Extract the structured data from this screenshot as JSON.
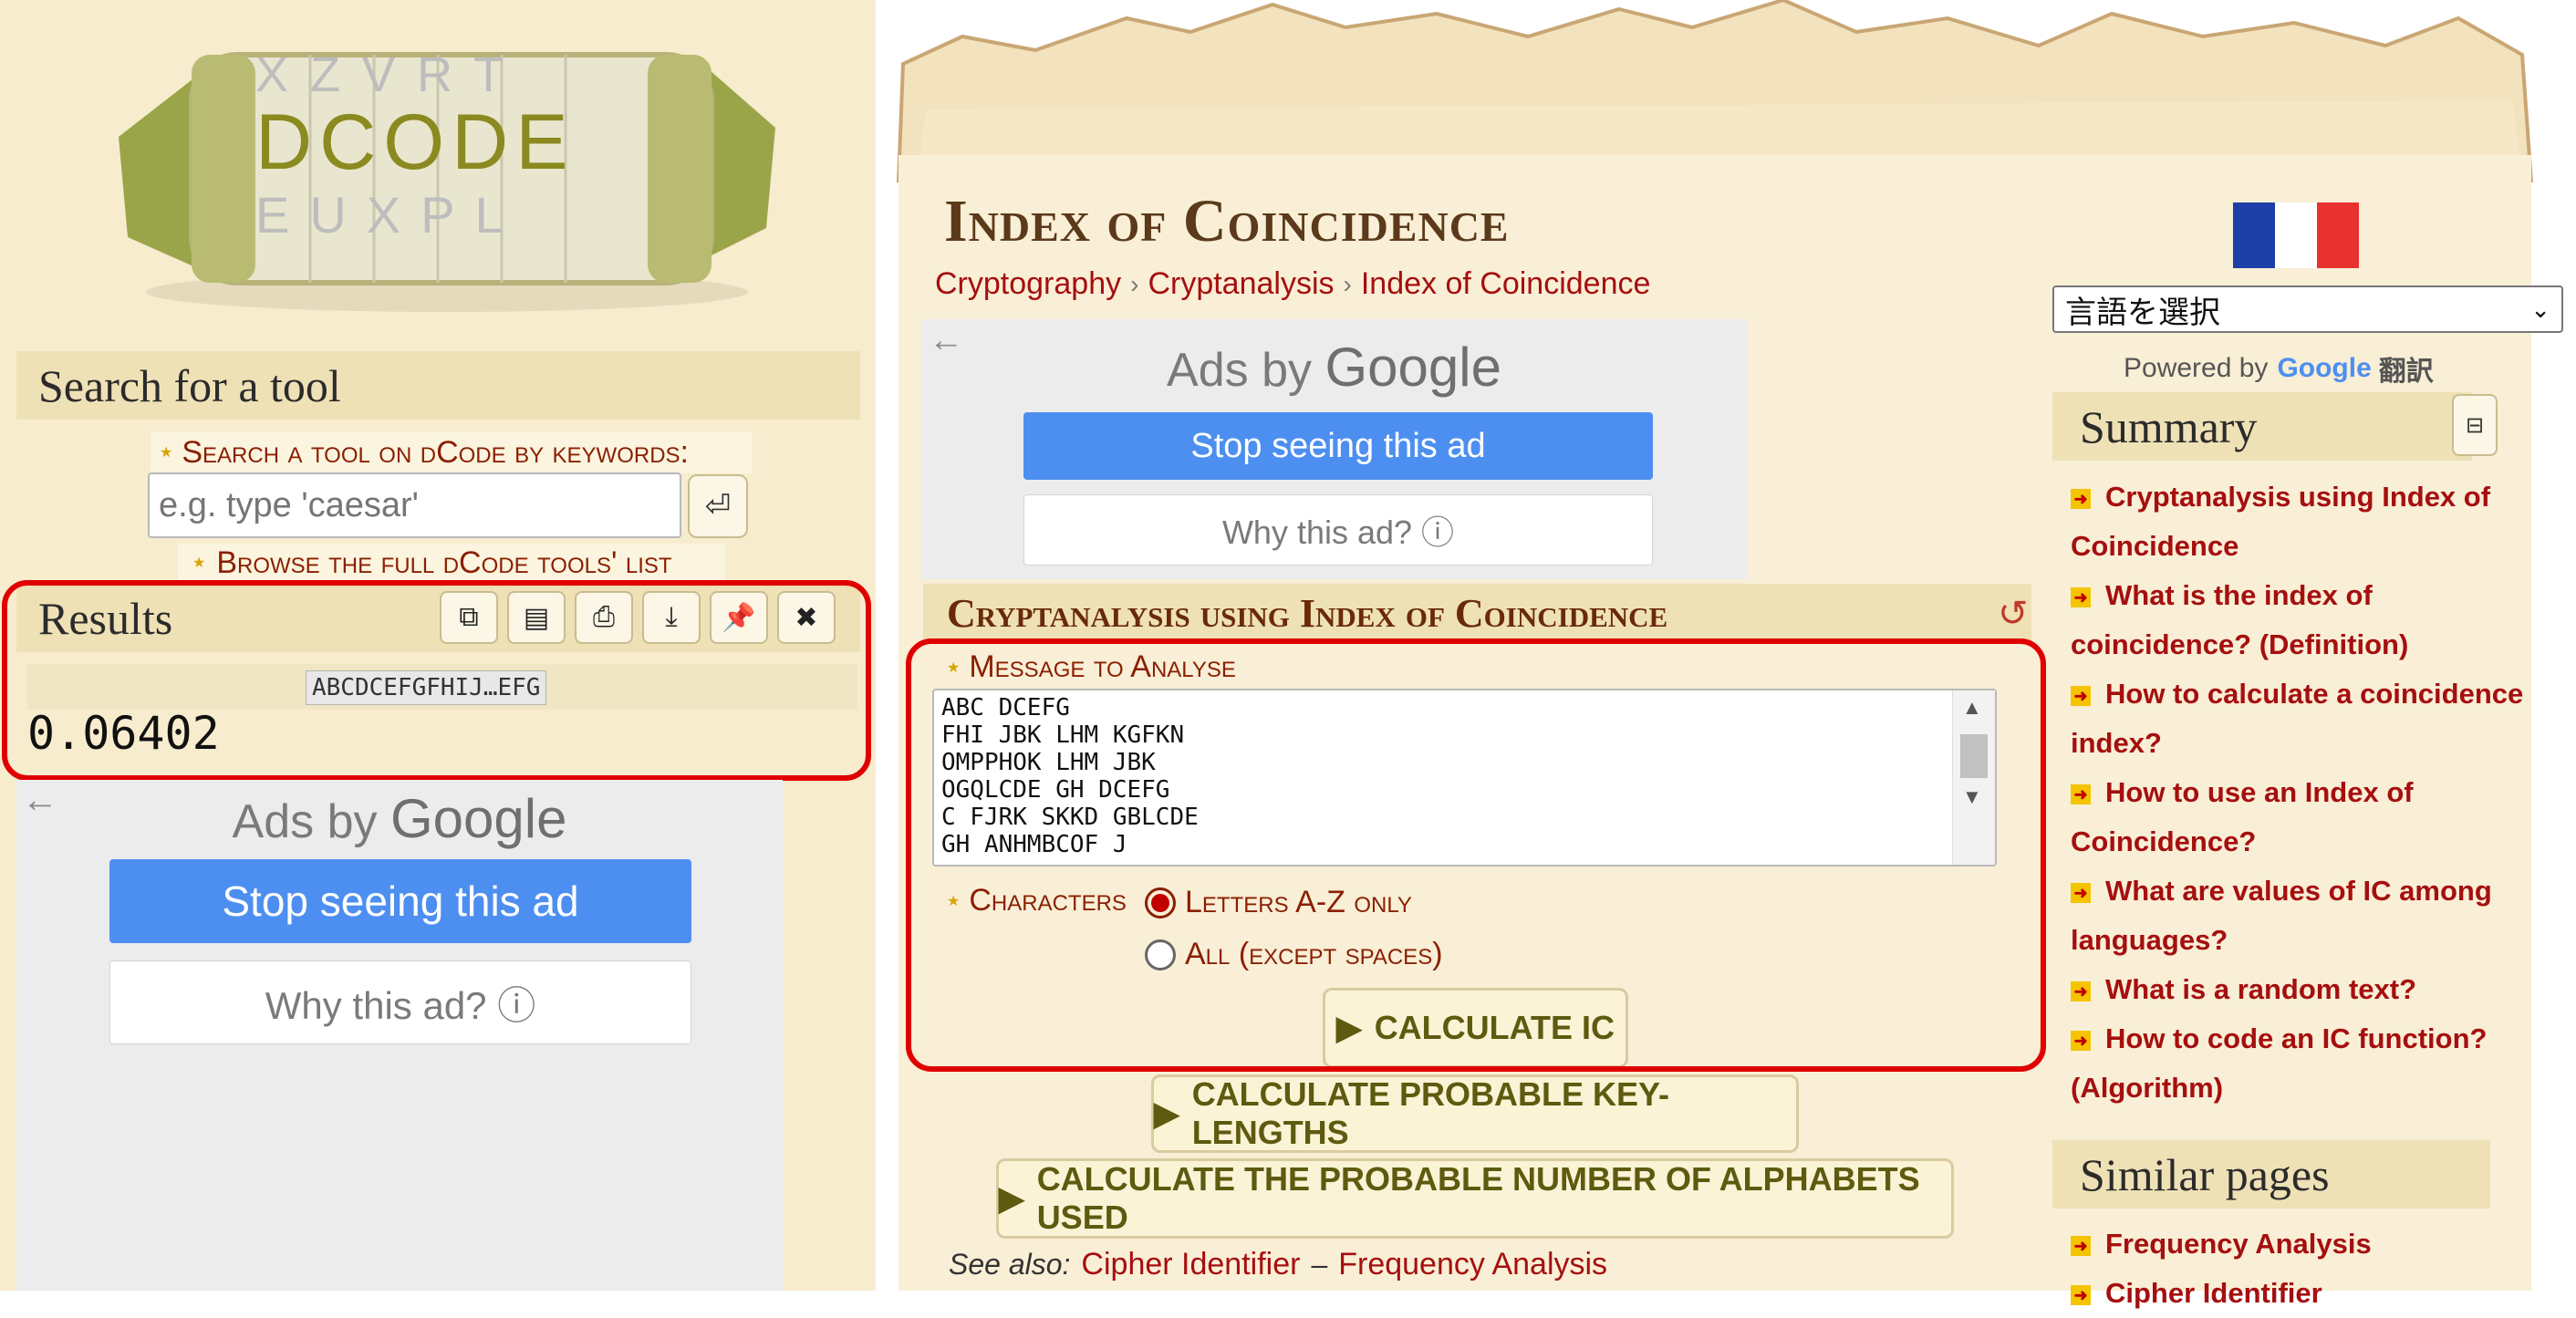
{
  "logo": {
    "text": "DCODE",
    "wheel_top": "XZVRT",
    "wheel_bottom": "EUXPL"
  },
  "search": {
    "section_title": "Search for a tool",
    "keyword_label": "Search a tool on dCode by keywords:",
    "placeholder": "e.g. type 'caesar'",
    "browse_label": "Browse the full dCode tools' list"
  },
  "results": {
    "title": "Results",
    "input_summary": "ABCDCEFGFHIJ…EFG",
    "value": "0.06402"
  },
  "ads": {
    "ads_by": "Ads by",
    "google": "Google",
    "stop_label": "Stop seeing this ad",
    "why_label": "Why this ad? ⓘ"
  },
  "page": {
    "title": "Index of Coincidence",
    "breadcrumbs": [
      "Cryptography",
      "Cryptanalysis",
      "Index of Coincidence"
    ]
  },
  "tool": {
    "section_title": "Cryptanalysis using Index of Coincidence",
    "message_label": "Message to Analyse",
    "message_value": "ABC DCEFG\nFHI JBK LHM KGFKN\nOMPPHOK LHM JBK\nOGQLCDE GH DCEFG\nC FJRK SKKD GBLCDE\nGH ANHMBCOF J",
    "characters_label": "Characters",
    "option_letters": "Letters A-Z only",
    "option_all": "All (except spaces)",
    "selected_option": "Letters A-Z only",
    "calc_ic": "CALCULATE IC",
    "calc_keylengths": "CALCULATE PROBABLE KEY-LENGTHS",
    "calc_alphabets": "CALCULATE THE PROBABLE NUMBER OF ALPHABETS USED"
  },
  "see_also": {
    "label": "See also:",
    "links": [
      "Cipher Identifier",
      "Frequency Analysis"
    ],
    "separator": "–"
  },
  "translate": {
    "select_value": "言語を選択",
    "powered_by": "Powered by",
    "google": "Google",
    "translate_word": "翻訳"
  },
  "summary": {
    "title": "Summary",
    "items": [
      "Cryptanalysis using Index of Coincidence",
      "What is the index of coincidence? (Definition)",
      "How to calculate a coincidence index?",
      "How to use an Index of Coincidence?",
      "What are values of IC among languages?",
      "What is a random text?",
      "How to code an IC function? (Algorithm)"
    ]
  },
  "similar": {
    "title": "Similar pages",
    "items": [
      "Frequency Analysis",
      "Cipher Identifier"
    ]
  },
  "colors": {
    "highlight_frame": "#e00000",
    "link": "#a50f0f",
    "ad_blue": "#4d8ff0",
    "parchment": "#f9eed6"
  }
}
